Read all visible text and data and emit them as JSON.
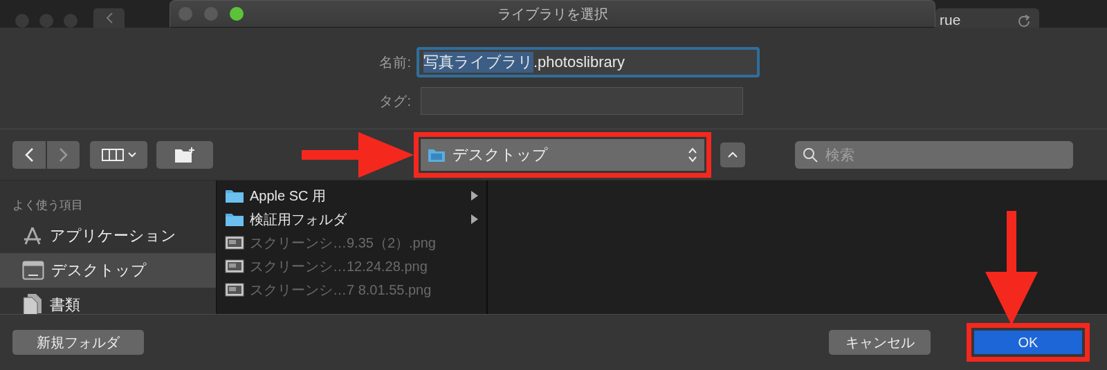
{
  "background_window_right": {
    "text": "rue"
  },
  "window": {
    "title": "ライブラリを選択"
  },
  "name_field": {
    "label": "名前:",
    "selected_text": "写真ライブラリ",
    "rest_text": ".photoslibrary",
    "focused": true
  },
  "tags_field": {
    "label": "タグ:"
  },
  "location": {
    "value": "デスクトップ",
    "highlighted": true
  },
  "search": {
    "placeholder": "検索"
  },
  "sidebar": {
    "header": "よく使う項目",
    "items": [
      {
        "label": "アプリケーション",
        "kind": "apps",
        "selected": false
      },
      {
        "label": "デスクトップ",
        "kind": "desktop",
        "selected": true
      },
      {
        "label": "書類",
        "kind": "documents",
        "selected": false
      }
    ]
  },
  "files": [
    {
      "name": "Apple SC 用",
      "kind": "folder",
      "disabled": false
    },
    {
      "name": "検証用フォルダ",
      "kind": "folder",
      "disabled": false
    },
    {
      "name": "スクリーンシ…9.35（2）.png",
      "kind": "image",
      "disabled": true
    },
    {
      "name": "スクリーンシ…12.24.28.png",
      "kind": "image",
      "disabled": true
    },
    {
      "name": "スクリーンシ…7 8.01.55.png",
      "kind": "image",
      "disabled": true
    }
  ],
  "buttons": {
    "new_folder": "新規フォルダ",
    "cancel": "キャンセル",
    "ok": "OK",
    "ok_highlighted": true
  }
}
